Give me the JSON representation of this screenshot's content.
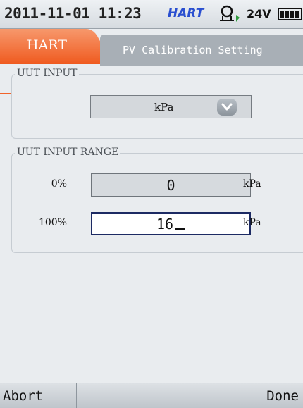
{
  "status_bar": {
    "datetime": "2011-11-01 11:23",
    "protocol": "HART",
    "loop_power_icon": "loop-power-icon",
    "voltage": "24V",
    "battery_icon": "battery-icon"
  },
  "header": {
    "mode_tab": "HART",
    "title": "PV Calibration Setting"
  },
  "uut_input": {
    "legend": "UUT INPUT",
    "unit_value": "kPa",
    "dropdown_icon": "chevron-down-icon"
  },
  "uut_input_range": {
    "legend": "UUT INPUT RANGE",
    "low": {
      "label": "0%",
      "value": "0",
      "unit": "kPa"
    },
    "high": {
      "label": "100%",
      "value": "16",
      "unit": "kPa"
    }
  },
  "softkeys": {
    "f1": "Abort",
    "f2": "",
    "f3": "",
    "f4": "Done"
  },
  "colors": {
    "accent_orange": "#f1632a",
    "hart_blue": "#2a4fd0",
    "title_tab_gray": "#a8afb6"
  }
}
